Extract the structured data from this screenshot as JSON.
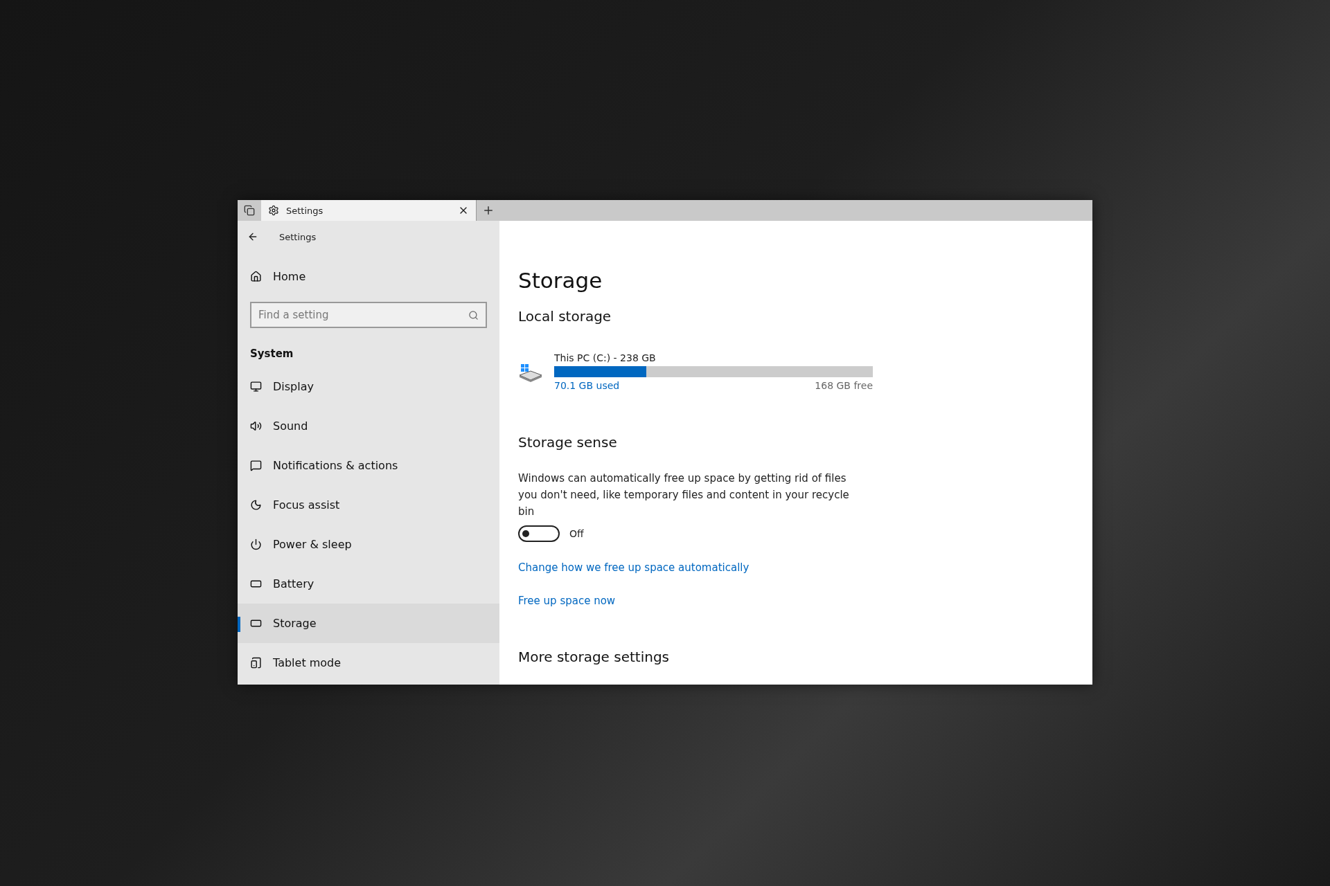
{
  "tabs": [
    {
      "label": "Settings",
      "selected": true
    }
  ],
  "sidebar": {
    "header": "Settings",
    "home": "Home",
    "search": {
      "placeholder": "Find a setting"
    },
    "section": "System",
    "items": [
      {
        "label": "Display",
        "selected": false
      },
      {
        "label": "Sound",
        "selected": false
      },
      {
        "label": "Notifications & actions",
        "selected": false
      },
      {
        "label": "Focus assist",
        "selected": false
      },
      {
        "label": "Power & sleep",
        "selected": false
      },
      {
        "label": "Battery",
        "selected": false
      },
      {
        "label": "Storage",
        "selected": true
      },
      {
        "label": "Tablet mode",
        "selected": false
      }
    ]
  },
  "content": {
    "title": "Storage",
    "local_storage": {
      "heading": "Local storage",
      "drive": {
        "name": "This PC (C:) - 238 GB",
        "level": 0.29,
        "used": "70.1 GB used",
        "free": "168 GB free"
      }
    },
    "storage_sense": {
      "heading": "Storage sense",
      "description": "Windows can automatically free up space by getting rid of files you don't need, like temporary files and content in your recycle bin",
      "toggle": {
        "on": false,
        "label": "Off"
      },
      "links": [
        "Change how we free up space automatically",
        "Free up space now"
      ]
    },
    "more_heading": "More storage settings"
  }
}
